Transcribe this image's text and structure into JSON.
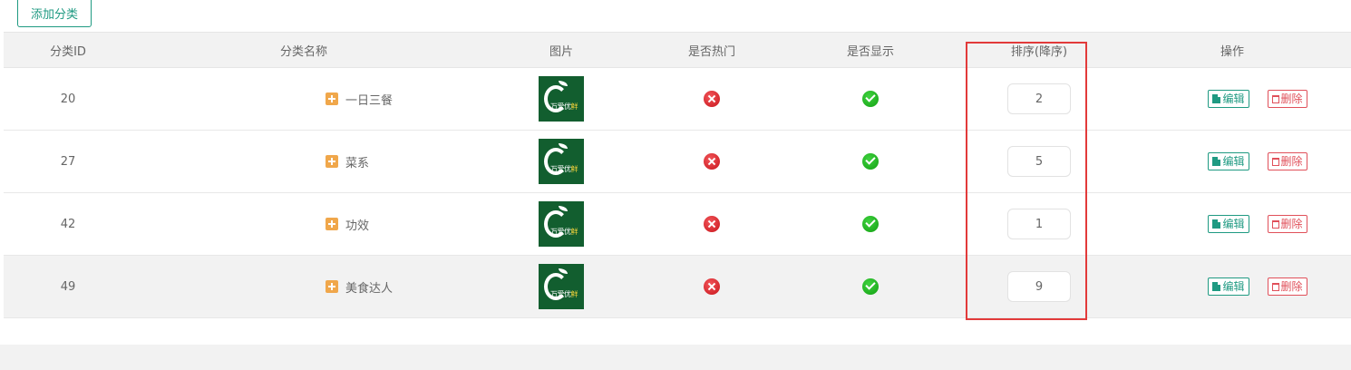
{
  "toolbar": {
    "add_label": "添加分类"
  },
  "table": {
    "headers": {
      "id": "分类ID",
      "name": "分类名称",
      "image": "图片",
      "hot": "是否热门",
      "show": "是否显示",
      "sort": "排序(降序)",
      "ops": "操作"
    },
    "rows": [
      {
        "id": "20",
        "name": "一日三餐",
        "hot": "no-icon",
        "show": "yes-icon",
        "sort": "2"
      },
      {
        "id": "27",
        "name": "菜系",
        "hot": "no-icon",
        "show": "yes-icon",
        "sort": "5"
      },
      {
        "id": "42",
        "name": "功效",
        "hot": "no-icon",
        "show": "yes-icon",
        "sort": "1"
      },
      {
        "id": "49",
        "name": "美食达人",
        "hot": "no-icon",
        "show": "yes-icon",
        "sort": "9"
      }
    ],
    "thumb_text": {
      "part1": "万爱优",
      "part2": "鲜"
    },
    "edit_label": "编辑",
    "delete_label": "删除"
  },
  "colors": {
    "accent": "#1f9a82",
    "danger": "#e0505a",
    "highlight": "#e23a3a",
    "thumb_bg": "#125e2f"
  }
}
